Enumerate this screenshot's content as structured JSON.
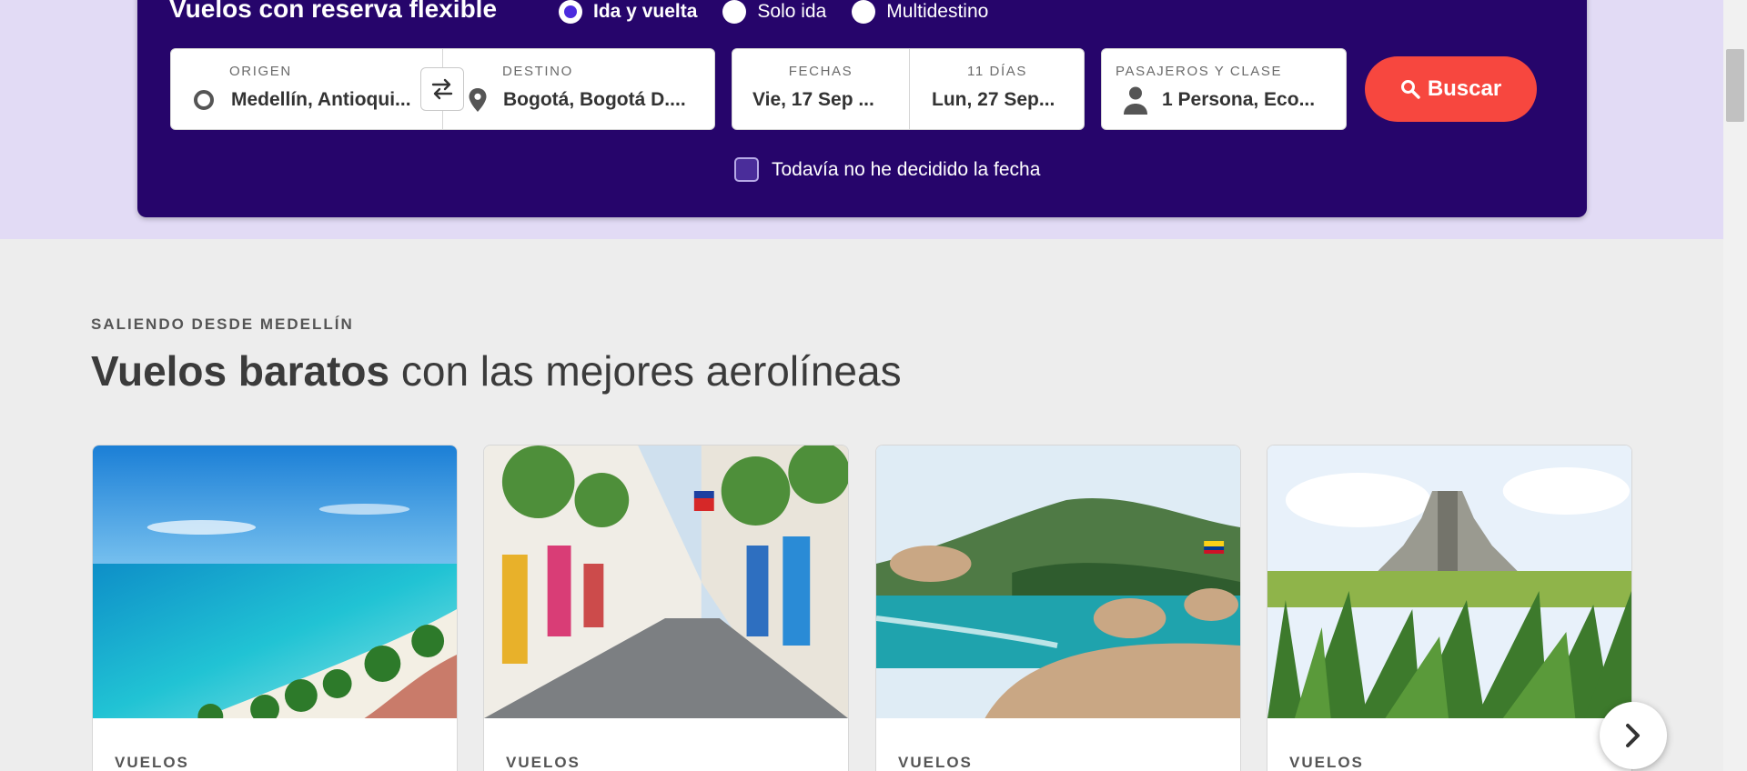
{
  "search": {
    "title": "Vuelos con reserva flexible",
    "trip_types": [
      {
        "label": "Ida y vuelta",
        "selected": true
      },
      {
        "label": "Solo ida",
        "selected": false
      },
      {
        "label": "Multidestino",
        "selected": false
      }
    ],
    "origin": {
      "caption": "ORIGEN",
      "value": "Medellín, Antioqui..."
    },
    "destination": {
      "caption": "DESTINO",
      "value": "Bogotá, Bogotá D...."
    },
    "dates": {
      "caption": "FECHAS",
      "duration_caption": "11 DÍAS",
      "departure": "Vie, 17 Sep ...",
      "return": "Lun, 27 Sep..."
    },
    "passengers": {
      "caption": "PASAJEROS Y CLASE",
      "value": "1 Persona, Eco..."
    },
    "search_button": "Buscar",
    "flexible_date_label": "Todavía no he decidido la fecha",
    "flexible_date_checked": false
  },
  "section": {
    "eyebrow": "SALIENDO DESDE MEDELLÍN",
    "headline_bold": "Vuelos baratos",
    "headline_rest": " con las mejores aerolíneas"
  },
  "cards": [
    {
      "kicker": "VUELOS",
      "image": "tropical-beach-photo"
    },
    {
      "kicker": "VUELOS",
      "image": "colonial-street-photo"
    },
    {
      "kicker": "VUELOS",
      "image": "rocky-coast-photo"
    },
    {
      "kicker": "VUELOS",
      "image": "mayan-pyramid-photo"
    }
  ],
  "colors": {
    "panel": "#26056b",
    "band": "#e2dbf5",
    "accent": "#f7473f",
    "radio_dot": "#4b2bde"
  }
}
